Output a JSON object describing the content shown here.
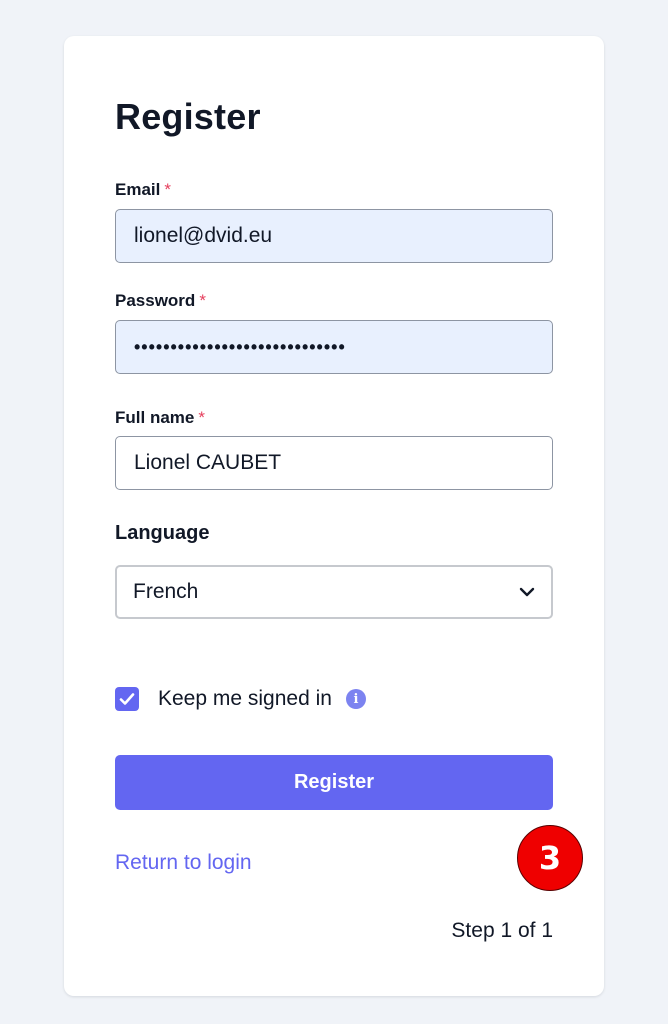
{
  "form": {
    "title": "Register",
    "email": {
      "label": "Email",
      "required_mark": "*",
      "value": "lionel@dvid.eu"
    },
    "password": {
      "label": "Password",
      "required_mark": "*",
      "value": "•••••••••••••••••••••••••••••"
    },
    "full_name": {
      "label": "Full name",
      "required_mark": "*",
      "value": "Lionel CAUBET"
    },
    "language": {
      "label": "Language",
      "selected": "French"
    },
    "keep_signed_in": {
      "label": "Keep me signed in",
      "checked": true,
      "info_icon": "info-icon"
    },
    "register_button": "Register",
    "return_link": "Return to login",
    "step": "Step 1 of 1"
  },
  "badge": {
    "number": "3"
  },
  "colors": {
    "accent": "#6366f1",
    "required": "#e53e5c",
    "autofill_bg": "#e8f0fe",
    "badge": "#ef0000",
    "page_bg": "#f0f3f8"
  }
}
